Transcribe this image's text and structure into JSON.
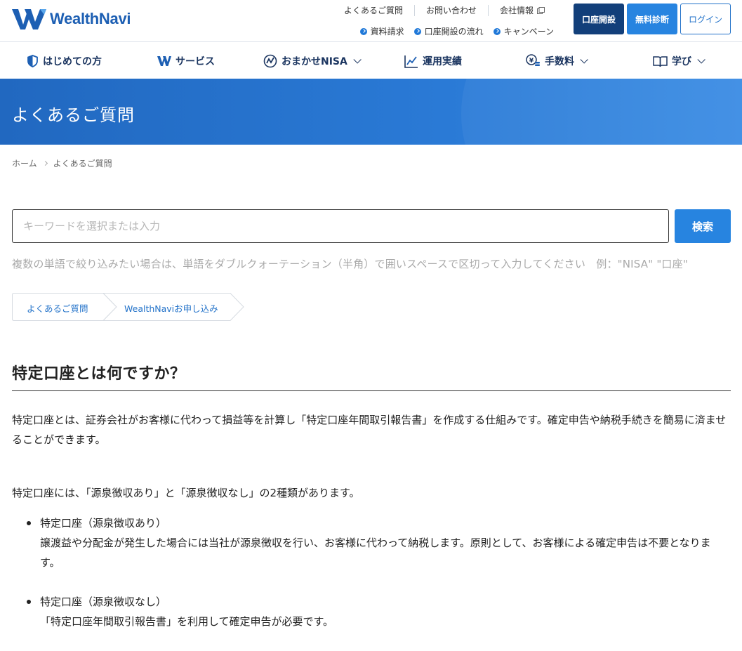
{
  "brand": {
    "name": "WealthNavi",
    "color": "#1d5fb3",
    "accent": "#2784e0",
    "dark": "#123f7a"
  },
  "header": {
    "util_links": [
      "よくあるご質問",
      "お問い合わせ",
      "会社情報"
    ],
    "sub_links": [
      "資料請求",
      "口座開設の流れ",
      "キャンペーン"
    ],
    "buttons": {
      "open_account": "口座開設",
      "free_diagnosis": "無料診断",
      "login": "ログイン"
    }
  },
  "nav": {
    "items": [
      {
        "label": "はじめての方",
        "icon": "shield-icon",
        "has_dropdown": false
      },
      {
        "label": "サービス",
        "icon": "w-logo-icon",
        "has_dropdown": false
      },
      {
        "label": "おまかせNISA",
        "icon": "nisa-icon",
        "has_dropdown": true
      },
      {
        "label": "運用実績",
        "icon": "chart-icon",
        "has_dropdown": false
      },
      {
        "label": "手数料",
        "icon": "yen-coin-icon",
        "has_dropdown": true
      },
      {
        "label": "学び",
        "icon": "book-icon",
        "has_dropdown": true
      }
    ]
  },
  "hero": {
    "title": "よくあるご質問"
  },
  "breadcrumb": [
    "ホーム",
    "よくあるご質問"
  ],
  "search": {
    "placeholder": "キーワードを選択または入力",
    "value": "",
    "button_label": "検索",
    "hint": "複数の単語で絞り込みたい場合は、単語をダブルクォーテーション（半角）で囲いスペースで区切って入力してください　例：\"NISA\" \"口座\""
  },
  "categories": [
    "よくあるご質問",
    "WealthNaviお申し込み"
  ],
  "article": {
    "title": "特定口座とは何ですか？",
    "paragraphs": [
      "特定口座とは、証券会社がお客様に代わって損益等を計算し「特定口座年間取引報告書」を作成する仕組みです。確定申告や納税手続きを簡易に済ませることができます。",
      "特定口座には、「源泉徴収あり」と「源泉徴収なし」の2種類があります。"
    ],
    "bullets": [
      {
        "head": "特定口座（源泉徴収あり）",
        "body": "譲渡益や分配金が発生した場合には当社が源泉徴収を行い、お客様に代わって納税します。原則として、お客様による確定申告は不要となります。"
      },
      {
        "head": "特定口座（源泉徴収なし）",
        "body": "「特定口座年間取引報告書」を利用して確定申告が必要です。"
      }
    ]
  }
}
